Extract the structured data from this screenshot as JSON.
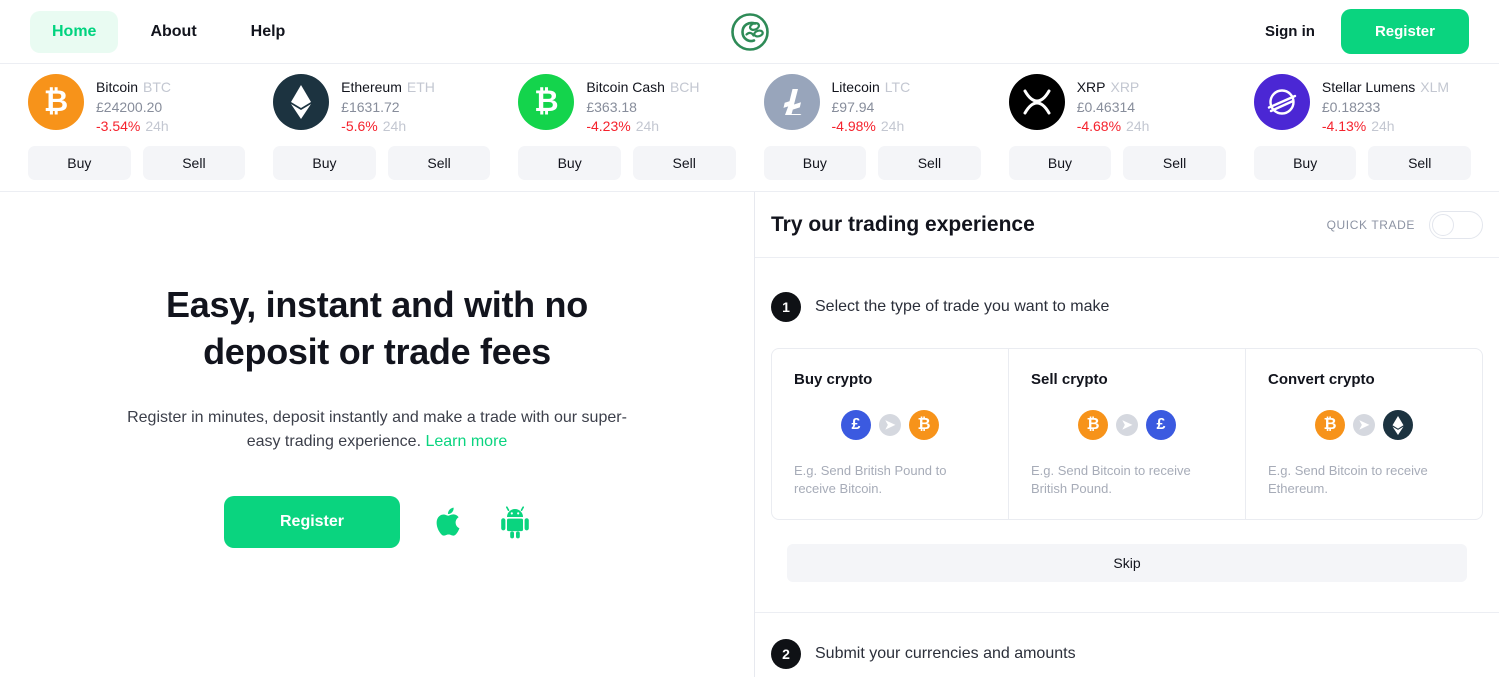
{
  "header": {
    "nav_items": [
      {
        "label": "Home",
        "active": true
      },
      {
        "label": "About",
        "active": false
      },
      {
        "label": "Help",
        "active": false
      }
    ],
    "logo_name": "crypto-leaf-logo",
    "signin_label": "Sign in",
    "register_label": "Register",
    "accent_color": "#0ad47f",
    "active_nav_bg": "#e9fbf2"
  },
  "tickers": [
    {
      "name": "Bitcoin",
      "symbol": "BTC",
      "price": "£24200.20",
      "change": "-3.54%",
      "period": "24h",
      "icon_name": "bitcoin-icon",
      "icon_color": "#f7931a",
      "glyph": "Ƀ",
      "buy_label": "Buy",
      "sell_label": "Sell"
    },
    {
      "name": "Ethereum",
      "symbol": "ETH",
      "price": "£1631.72",
      "change": "-5.6%",
      "period": "24h",
      "icon_name": "ethereum-icon",
      "icon_color": "#1c3340",
      "glyph": "",
      "buy_label": "Buy",
      "sell_label": "Sell"
    },
    {
      "name": "Bitcoin Cash",
      "symbol": "BCH",
      "price": "£363.18",
      "change": "-4.23%",
      "period": "24h",
      "icon_name": "bitcoin-cash-icon",
      "icon_color": "#14d44c",
      "glyph": "Ƀ",
      "buy_label": "Buy",
      "sell_label": "Sell"
    },
    {
      "name": "Litecoin",
      "symbol": "LTC",
      "price": "£97.94",
      "change": "-4.98%",
      "period": "24h",
      "icon_name": "litecoin-icon",
      "icon_color": "#98a5bb",
      "glyph": "Ł",
      "buy_label": "Buy",
      "sell_label": "Sell"
    },
    {
      "name": "XRP",
      "symbol": "XRP",
      "price": "£0.46314",
      "change": "-4.68%",
      "period": "24h",
      "icon_name": "xrp-icon",
      "icon_color": "#000000",
      "glyph": "",
      "buy_label": "Buy",
      "sell_label": "Sell"
    },
    {
      "name": "Stellar Lumens",
      "symbol": "XLM",
      "price": "£0.18233",
      "change": "-4.13%",
      "period": "24h",
      "icon_name": "stellar-icon",
      "icon_color": "#4b27d4",
      "glyph": "",
      "buy_label": "Buy",
      "sell_label": "Sell"
    }
  ],
  "hero": {
    "heading": "Easy, instant and with no deposit or trade fees",
    "subtext": "Register in minutes, deposit instantly and make a trade with our super-easy trading experience. ",
    "link_label": "Learn more",
    "register_label": "Register",
    "apple_icon_name": "apple-store-icon",
    "android_icon_name": "android-store-icon"
  },
  "panel": {
    "title": "Try our trading experience",
    "quick_trade_label": "QUICK TRADE",
    "quick_trade_on": false,
    "steps": [
      {
        "number": "1",
        "label": "Select the type of trade you want to make"
      },
      {
        "number": "2",
        "label": "Submit your currencies and amounts"
      }
    ],
    "trade_cards": [
      {
        "title": "Buy crypto",
        "from_icon": "gbp-icon",
        "from_color": "#3b5ae0",
        "from_glyph": "£",
        "to_icon": "bitcoin-icon",
        "to_color": "#f7931a",
        "to_glyph": "Ƀ",
        "arrow_icon": "arrow-right-icon",
        "description": "E.g. Send British Pound to receive Bitcoin."
      },
      {
        "title": "Sell crypto",
        "from_icon": "bitcoin-icon",
        "from_color": "#f7931a",
        "from_glyph": "Ƀ",
        "to_icon": "gbp-icon",
        "to_color": "#3b5ae0",
        "to_glyph": "£",
        "arrow_icon": "arrow-right-icon",
        "description": "E.g. Send Bitcoin to receive British Pound."
      },
      {
        "title": "Convert crypto",
        "from_icon": "bitcoin-icon",
        "from_color": "#f7931a",
        "from_glyph": "Ƀ",
        "to_icon": "ethereum-icon",
        "to_color": "#1c3340",
        "to_glyph": "",
        "arrow_icon": "arrow-right-icon",
        "description": "E.g. Send Bitcoin to receive Ethereum."
      }
    ],
    "skip_label": "Skip"
  }
}
